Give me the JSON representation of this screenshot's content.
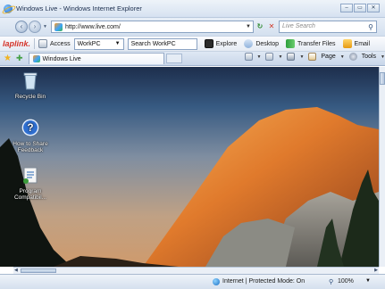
{
  "window": {
    "title": "Windows Live - Windows Internet Explorer",
    "minimize": "–",
    "maximize": "▭",
    "close": "✕"
  },
  "address": {
    "url": "http://www.live.com/",
    "search_placeholder": "Live Search"
  },
  "toolbar": {
    "brand": "laplink.",
    "access_label": "Access",
    "computer_select": "WorkPC",
    "search_text": "Search WorkPC",
    "explore_label": "Explore",
    "desktop_label": "Desktop",
    "transfer_label": "Transfer Files",
    "email_label": "Email"
  },
  "tabs": [
    {
      "label": "Windows Live"
    }
  ],
  "commands": {
    "page_label": "Page",
    "tools_label": "Tools"
  },
  "desktop_icons": [
    {
      "label": "Recycle Bin",
      "icon": "recycle-bin-icon"
    },
    {
      "label": "How to Share Feedback",
      "icon": "help-icon"
    },
    {
      "label": "Program Compatibil...",
      "icon": "program-compatibility-icon"
    }
  ],
  "status": {
    "zone_text": "Internet | Protected Mode: On",
    "zoom": "100%"
  },
  "colors": {
    "brand_red": "#d4342a",
    "frame": "#d6e2f1"
  }
}
